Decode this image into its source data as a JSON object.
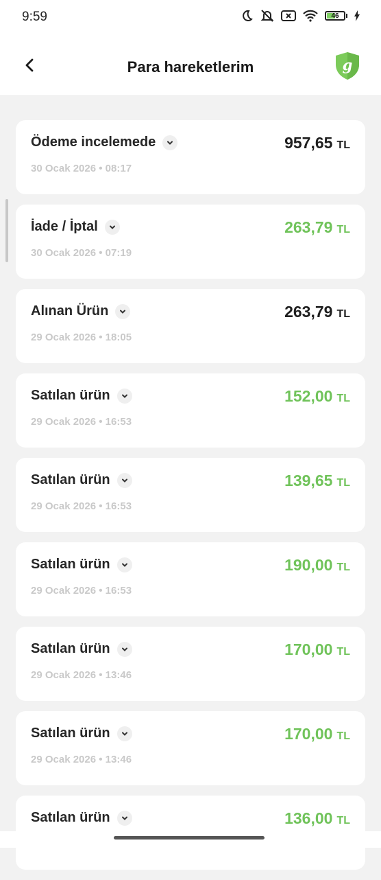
{
  "status_bar": {
    "time": "9:59",
    "battery_level": "46",
    "icons": [
      "moon-icon",
      "mute-notification-icon",
      "sim-error-icon",
      "wifi-icon",
      "battery-icon",
      "charging-icon"
    ]
  },
  "header": {
    "title": "Para hareketlerim",
    "back_icon": "chevron-left-icon",
    "shield_letter": "g",
    "brand_color": "#7ccb5a"
  },
  "colors": {
    "positive": "#70c35a",
    "neutral": "#1f1f1f",
    "date": "#c9c9c9"
  },
  "transactions": [
    {
      "title": "Ödeme incelemede",
      "date": "30 Ocak 2026 • 08:17",
      "amount": "957,65",
      "currency": "TL",
      "status": "neutral"
    },
    {
      "title": "İade / İptal",
      "date": "30 Ocak 2026 • 07:19",
      "amount": "263,79",
      "currency": "TL",
      "status": "positive"
    },
    {
      "title": "Alınan Ürün",
      "date": "29 Ocak 2026 • 18:05",
      "amount": "263,79",
      "currency": "TL",
      "status": "neutral"
    },
    {
      "title": "Satılan ürün",
      "date": "29 Ocak 2026 • 16:53",
      "amount": "152,00",
      "currency": "TL",
      "status": "positive"
    },
    {
      "title": "Satılan ürün",
      "date": "29 Ocak 2026 • 16:53",
      "amount": "139,65",
      "currency": "TL",
      "status": "positive"
    },
    {
      "title": "Satılan ürün",
      "date": "29 Ocak 2026 • 16:53",
      "amount": "190,00",
      "currency": "TL",
      "status": "positive"
    },
    {
      "title": "Satılan ürün",
      "date": "29 Ocak 2026 • 13:46",
      "amount": "170,00",
      "currency": "TL",
      "status": "positive"
    },
    {
      "title": "Satılan ürün",
      "date": "29 Ocak 2026 • 13:46",
      "amount": "170,00",
      "currency": "TL",
      "status": "positive"
    },
    {
      "title": "Satılan ürün",
      "date": "",
      "amount": "136,00",
      "currency": "TL",
      "status": "positive"
    }
  ]
}
